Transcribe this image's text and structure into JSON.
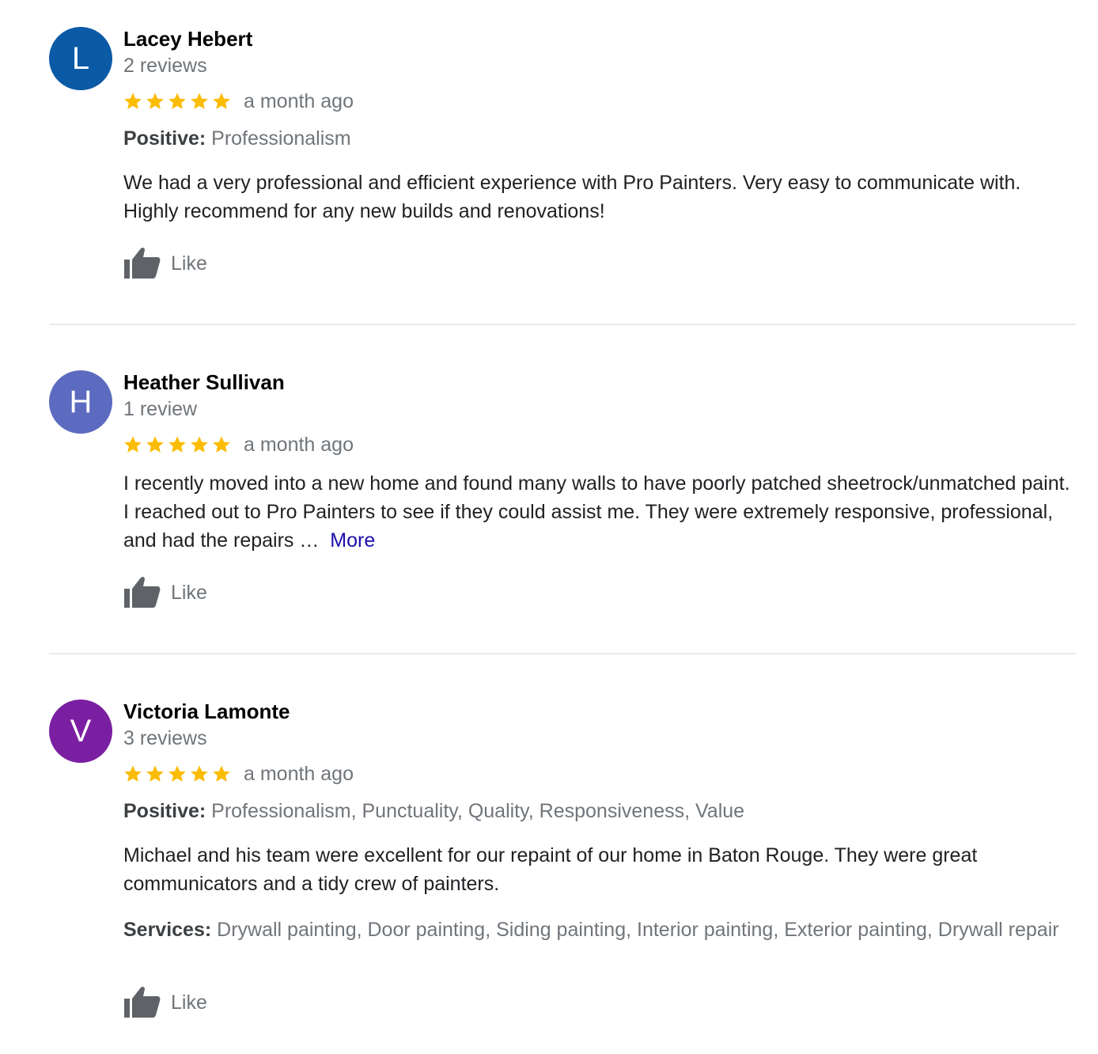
{
  "reviews": [
    {
      "initial": "L",
      "avatar_color": "#0b5aa6",
      "name": "Lacey Hebert",
      "review_count": "2 reviews",
      "stars": 5,
      "time": "a month ago",
      "positive_label": "Positive:",
      "positive_value": " Professionalism",
      "text": "We had a very professional and efficient experience with Pro Painters. Very easy to communicate with. Highly recommend for any new builds and renovations!",
      "like_label": "Like"
    },
    {
      "initial": "H",
      "avatar_color": "#5c6bc0",
      "name": "Heather Sullivan",
      "review_count": "1 review",
      "stars": 5,
      "time": "a month ago",
      "text": "I recently moved into a new home and found many walls to have poorly patched sheetrock/unmatched paint. I reached out to Pro Painters to see if they could assist me. They were extremely responsive, professional, and had the repairs …",
      "more_label": "More",
      "like_label": "Like"
    },
    {
      "initial": "V",
      "avatar_color": "#7b1fa2",
      "name": "Victoria Lamonte",
      "review_count": "3 reviews",
      "stars": 5,
      "time": "a month ago",
      "positive_label": "Positive:",
      "positive_value": " Professionalism, Punctuality, Quality, Responsiveness, Value",
      "text": "Michael and his team were excellent for our repaint of our home in Baton Rouge. They were great communicators and a tidy crew of painters.",
      "services_label": "Services:",
      "services_value": " Drywall painting, Door painting, Siding painting, Interior painting, Exterior painting, Drywall repair",
      "like_label": "Like"
    }
  ],
  "colors": {
    "star": "#fbbc04",
    "link": "#1a0dab",
    "secondary_text": "#70757a",
    "like_icon": "#5f6368"
  }
}
